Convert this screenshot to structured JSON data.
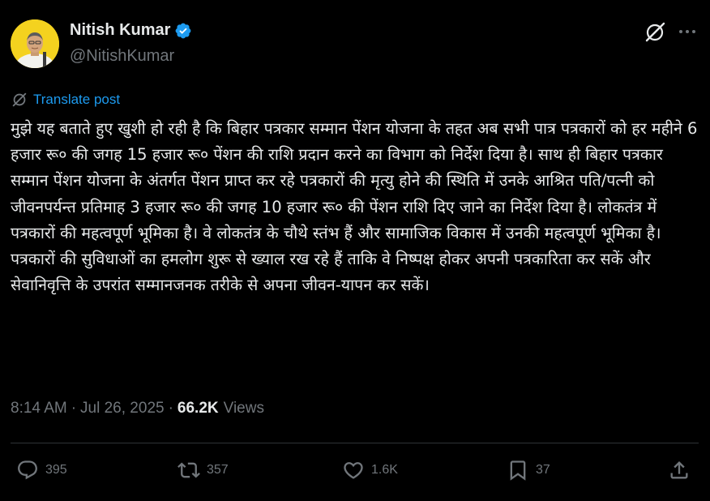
{
  "author": {
    "name": "Nitish Kumar",
    "handle": "@NitishKumar",
    "verified": true
  },
  "translate_label": "Translate post",
  "post_text": "मुझे यह बताते हुए खुशी हो रही है कि बिहार पत्रकार सम्मान पेंशन योजना के तहत अब सभी पात्र पत्रकारों को हर महीने 6 हजार रू० की जगह 15 हजार रू० पेंशन की राशि प्रदान करने का विभाग को निर्देश दिया है। साथ ही बिहार पत्रकार सम्मान पेंशन योजना के अंतर्गत पेंशन प्राप्त कर रहे पत्रकारों की मृत्यु होने की स्थिति में उनके आश्रित पति/पत्नी को जीवनपर्यन्त प्रतिमाह 3 हजार रू० की जगह 10 हजार रू० की पेंशन राशि दिए जाने का निर्देश दिया है। लोकतंत्र में पत्रकारों की महत्वपूर्ण भूमिका है। वे लोकतंत्र के चौथे स्तंभ हैं और सामाजिक विकास में उनकी महत्वपूर्ण भूमिका है। पत्रकारों की सुविधाओं का हमलोग शुरू से ख्याल रख रहे हैं ताकि वे निष्पक्ष होकर अपनी पत्रकारिता कर सकें और सेवानिवृत्ति के उपरांत सम्मानजनक तरीके से अपना जीवन-यापन कर सकें।",
  "meta": {
    "time": "8:14 AM",
    "separator": "·",
    "date": "Jul 26, 2025",
    "views_count": "66.2K",
    "views_label": "Views"
  },
  "actions": {
    "replies": "395",
    "reposts": "357",
    "likes": "1.6K",
    "bookmarks": "37"
  },
  "icons": {
    "grok": "grok-icon",
    "more": "more-icon",
    "translate": "translate-icon",
    "reply": "reply-icon",
    "repost": "repost-icon",
    "like": "heart-icon",
    "bookmark": "bookmark-icon",
    "share": "share-icon"
  },
  "colors": {
    "background": "#000000",
    "text": "#e7e9ea",
    "secondary": "#71767b",
    "accent": "#1d9bf0",
    "avatar_bg": "#f4d21f"
  }
}
